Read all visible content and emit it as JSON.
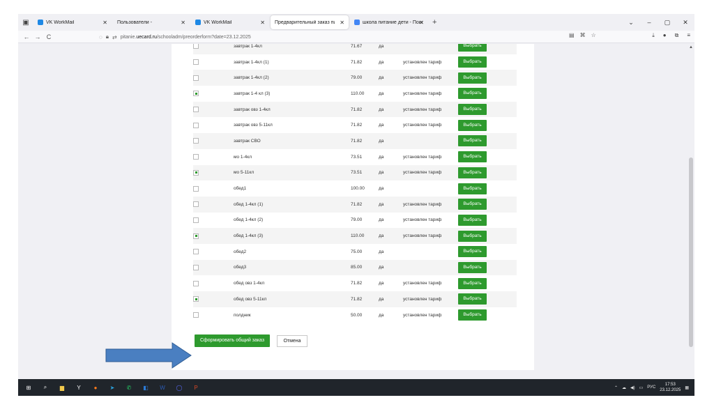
{
  "tabs": [
    {
      "label": "VK WorkMail",
      "fav_color": "#1e88e5",
      "active": false
    },
    {
      "label": "Пользователи -",
      "fav_color": "",
      "active": false
    },
    {
      "label": "VK WorkMail",
      "fav_color": "#1e88e5",
      "active": false
    },
    {
      "label": "Предварительный заказ пита",
      "fav_color": "",
      "active": true
    },
    {
      "label": "школа питание дети - Поиск в",
      "fav_color": "#4285f4",
      "active": false
    }
  ],
  "new_tab": "+",
  "window_controls": [
    "⌄",
    "–",
    "▢",
    "✕"
  ],
  "url": {
    "prefix": "pitanie.",
    "host": "uecard.ru",
    "path": "/schooladm/preorderform?date=23.12.2025"
  },
  "nav_icons": [
    "back-icon",
    "forward-icon",
    "reload-icon"
  ],
  "rows": [
    {
      "checked": false,
      "name": "завтрак 1-4кл",
      "price": "71.67",
      "yes": "да",
      "tariff": "",
      "button": "Выбрать"
    },
    {
      "checked": false,
      "name": "завтрак 1-4кл (1)",
      "price": "71.82",
      "yes": "да",
      "tariff": "установлен тариф",
      "button": "Выбрать"
    },
    {
      "checked": false,
      "name": "завтрак 1-4кл (2)",
      "price": "79.00",
      "yes": "да",
      "tariff": "установлен тариф",
      "button": "Выбрать"
    },
    {
      "checked": true,
      "name": "завтрак 1-4 кл (3)",
      "price": "110.00",
      "yes": "да",
      "tariff": "установлен тариф",
      "button": "Выбрать"
    },
    {
      "checked": false,
      "name": "завтрак овз 1-4кл",
      "price": "71.82",
      "yes": "да",
      "tariff": "установлен тариф",
      "button": "Выбрать"
    },
    {
      "checked": false,
      "name": "завтрак овз 5-11кл",
      "price": "71.82",
      "yes": "да",
      "tariff": "установлен тариф",
      "button": "Выбрать"
    },
    {
      "checked": false,
      "name": "завтрак СВО",
      "price": "71.82",
      "yes": "да",
      "tariff": "",
      "button": "Выбрать"
    },
    {
      "checked": false,
      "name": "мо 1-4кл",
      "price": "73.51",
      "yes": "да",
      "tariff": "установлен тариф",
      "button": "Выбрать"
    },
    {
      "checked": true,
      "name": "мо 5-11кл",
      "price": "73.51",
      "yes": "да",
      "tariff": "установлен тариф",
      "button": "Выбрать"
    },
    {
      "checked": false,
      "name": "обед1",
      "price": "100.00",
      "yes": "да",
      "tariff": "",
      "button": "Выбрать"
    },
    {
      "checked": false,
      "name": "обед 1-4кл (1)",
      "price": "71.82",
      "yes": "да",
      "tariff": "установлен тариф",
      "button": "Выбрать"
    },
    {
      "checked": false,
      "name": "обед 1-4кл (2)",
      "price": "79.00",
      "yes": "да",
      "tariff": "установлен тариф",
      "button": "Выбрать"
    },
    {
      "checked": true,
      "name": "обед 1-4кл (3)",
      "price": "110.00",
      "yes": "да",
      "tariff": "установлен тариф",
      "button": "Выбрать"
    },
    {
      "checked": false,
      "name": "обед2",
      "price": "75.00",
      "yes": "да",
      "tariff": "",
      "button": "Выбрать"
    },
    {
      "checked": false,
      "name": "обед3",
      "price": "85.00",
      "yes": "да",
      "tariff": "",
      "button": "Выбрать"
    },
    {
      "checked": false,
      "name": "обед овз 1-4кл",
      "price": "71.82",
      "yes": "да",
      "tariff": "установлен тариф",
      "button": "Выбрать"
    },
    {
      "checked": true,
      "name": "обед овз 5-11кл",
      "price": "71.82",
      "yes": "да",
      "tariff": "установлен тариф",
      "button": "Выбрать"
    },
    {
      "checked": false,
      "name": "полдник",
      "price": "50.00",
      "yes": "да",
      "tariff": "установлен тариф",
      "button": "Выбрать"
    }
  ],
  "actions": {
    "submit": "Сформировать общий заказ",
    "cancel": "Отмена"
  },
  "colors": {
    "green": "#2e9a2e",
    "arrow_fill": "#4a7fc1",
    "arrow_stroke": "#2f5d94",
    "taskbar": "#20252b"
  },
  "taskbar_icons": [
    {
      "name": "windows-start-icon",
      "color": "#ffffff",
      "glyph": "⊞"
    },
    {
      "name": "search-icon",
      "color": "#ffffff",
      "glyph": "⌕"
    },
    {
      "name": "file-explorer-icon",
      "color": "#f2c94c",
      "glyph": "▆"
    },
    {
      "name": "yandex-browser-icon",
      "color": "#ffffff",
      "glyph": "Y"
    },
    {
      "name": "firefox-icon",
      "color": "#ff7a1a",
      "glyph": "●"
    },
    {
      "name": "telegram-icon",
      "color": "#2aa3df",
      "glyph": "➤"
    },
    {
      "name": "whatsapp-icon",
      "color": "#25d366",
      "glyph": "✆"
    },
    {
      "name": "remote-desktop-icon",
      "color": "#2b7bd6",
      "glyph": "◧"
    },
    {
      "name": "word-icon",
      "color": "#2b5bb5",
      "glyph": "W"
    },
    {
      "name": "messenger-icon",
      "color": "#5b6cff",
      "glyph": "◯"
    },
    {
      "name": "powerpoint-icon",
      "color": "#d24726",
      "glyph": "P"
    }
  ],
  "tray": {
    "language": "РУС",
    "time": "17:53",
    "date": "23.12.2025"
  }
}
